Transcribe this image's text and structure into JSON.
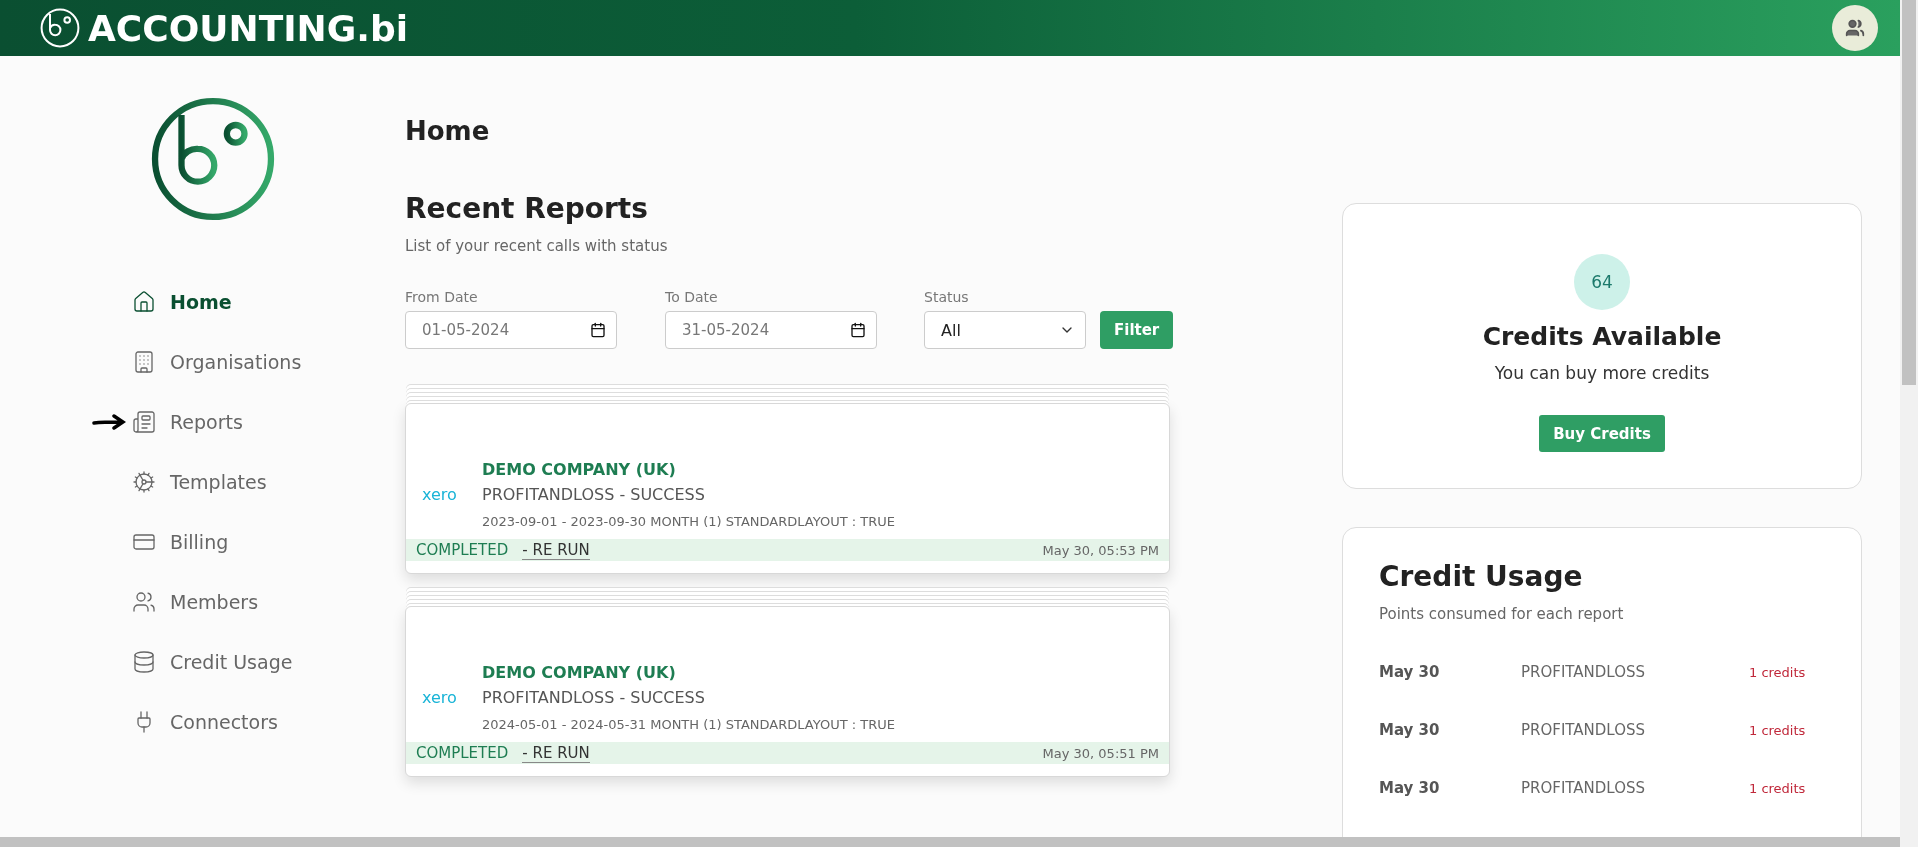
{
  "header": {
    "brand": "ACCOUNTING.bi"
  },
  "sidebar": {
    "items": [
      {
        "label": "Home",
        "selected": true,
        "pointer": false
      },
      {
        "label": "Organisations",
        "selected": false,
        "pointer": false
      },
      {
        "label": "Reports",
        "selected": false,
        "pointer": true
      },
      {
        "label": "Templates",
        "selected": false,
        "pointer": false
      },
      {
        "label": "Billing",
        "selected": false,
        "pointer": false
      },
      {
        "label": "Members",
        "selected": false,
        "pointer": false
      },
      {
        "label": "Credit Usage",
        "selected": false,
        "pointer": false
      },
      {
        "label": "Connectors",
        "selected": false,
        "pointer": false
      }
    ]
  },
  "page_title": "Home",
  "recent_reports": {
    "title": "Recent Reports",
    "subtitle": "List of your recent calls with status",
    "filters": {
      "from_label": "From Date",
      "from_value": "01-05-2024",
      "to_label": "To Date",
      "to_value": "31-05-2024",
      "status_label": "Status",
      "status_value": "All",
      "button": "Filter"
    },
    "reports": [
      {
        "company": "DEMO COMPANY (UK)",
        "report": "PROFITANDLOSS - SUCCESS",
        "details": "2023-09-01 - 2023-09-30 MONTH (1) STANDARDLAYOUT : TRUE",
        "status": "COMPLETED",
        "action": "- RE RUN",
        "time": "May 30, 05:53 PM",
        "provider": "xero"
      },
      {
        "company": "DEMO COMPANY (UK)",
        "report": "PROFITANDLOSS - SUCCESS",
        "details": "2024-05-01 - 2024-05-31 MONTH (1) STANDARDLAYOUT : TRUE",
        "status": "COMPLETED",
        "action": "- RE RUN",
        "time": "May 30, 05:51 PM",
        "provider": "xero"
      }
    ]
  },
  "credits": {
    "count": "64",
    "title": "Credits Available",
    "subtitle": "You can buy more credits",
    "button": "Buy Credits"
  },
  "credit_usage": {
    "title": "Credit Usage",
    "subtitle": "Points consumed for each report",
    "rows": [
      {
        "date": "May 30",
        "report": "PROFITANDLOSS",
        "credits": "1 credits"
      },
      {
        "date": "May 30",
        "report": "PROFITANDLOSS",
        "credits": "1 credits"
      },
      {
        "date": "May 30",
        "report": "PROFITANDLOSS",
        "credits": "1 credits"
      }
    ]
  }
}
